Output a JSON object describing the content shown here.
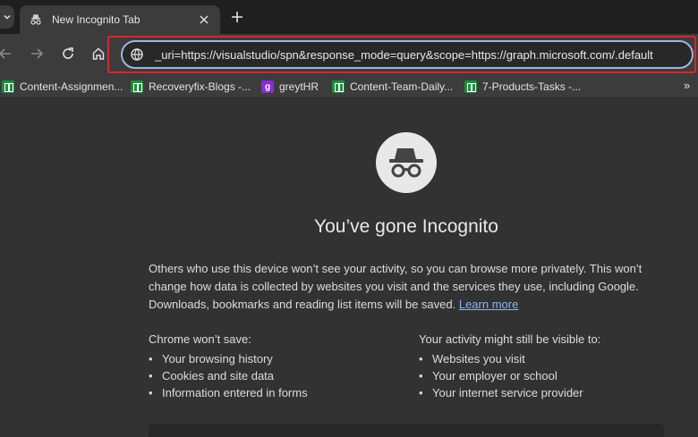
{
  "tab": {
    "title": "New Incognito Tab"
  },
  "omnibox": {
    "value": "_uri=https://visualstudio/spn&response_mode=query&scope=https://graph.microsoft.com/.default"
  },
  "bookmarks": [
    {
      "label": "Content-Assignmen...",
      "icon": "sheets-icon"
    },
    {
      "label": "Recoveryfix-Blogs -...",
      "icon": "sheets-icon"
    },
    {
      "label": "greytHR",
      "icon": "greythr-icon"
    },
    {
      "label": "Content-Team-Daily...",
      "icon": "sheets-icon"
    },
    {
      "label": "7-Products-Tasks -...",
      "icon": "sheets-icon"
    }
  ],
  "overflow": "»",
  "incognito": {
    "heading": "You’ve gone Incognito",
    "paragraph": "Others who use this device won’t see your activity, so you can browse more privately. This won’t change how data is collected by websites you visit and the services they use, including Google. Downloads, bookmarks and reading list items will be saved.",
    "learn_more": "Learn more",
    "wont_save": {
      "heading": "Chrome won’t save:",
      "items": [
        "Your browsing history",
        "Cookies and site data",
        "Information entered in forms"
      ]
    },
    "might_be_visible": {
      "heading_prefix": "Your activity ",
      "heading_bold": "might",
      "heading_suffix": " still be visible to:",
      "items": [
        "Websites you visit",
        "Your employer or school",
        "Your internet service provider"
      ]
    }
  },
  "colors": {
    "accent": "#8ab4f8",
    "highlight": "#d9262c",
    "sheets": "#1e8e3e",
    "greythr": "#8b2bd6"
  }
}
